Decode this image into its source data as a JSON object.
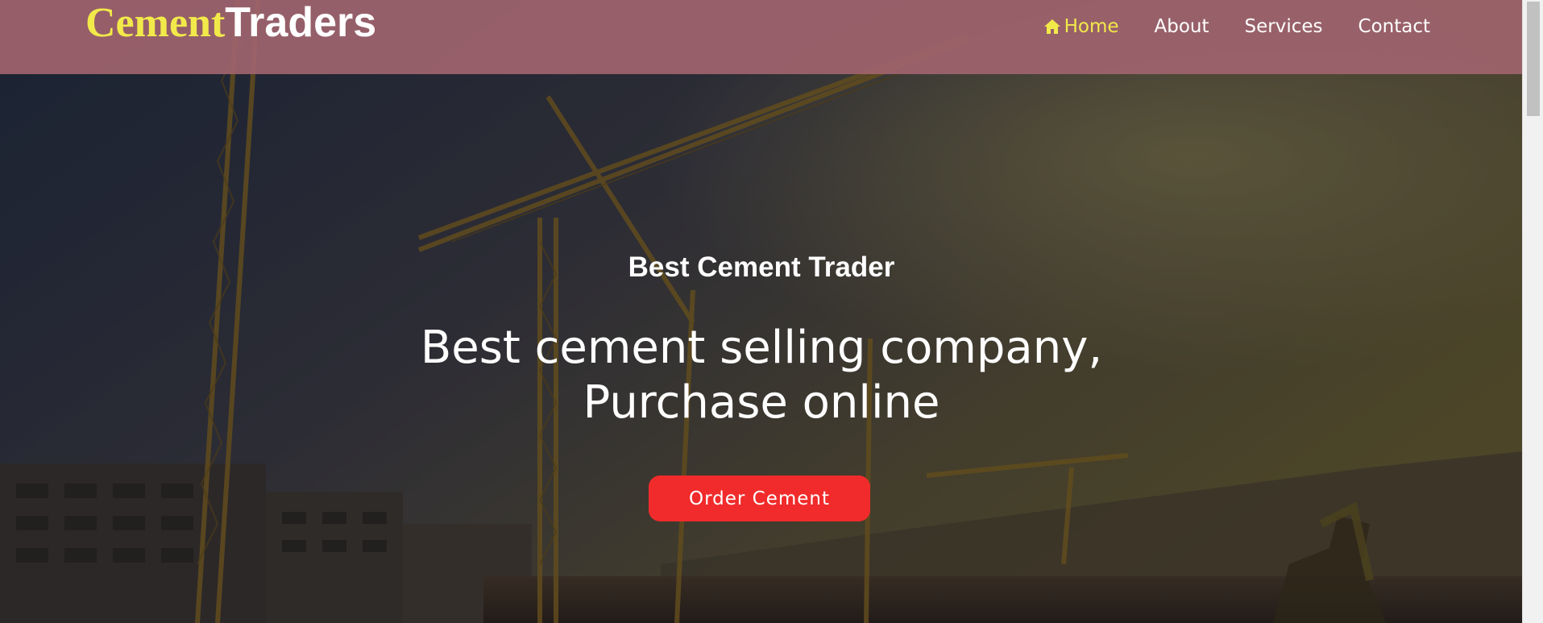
{
  "navbar": {
    "brand_part1": "Cement",
    "brand_part2": "Traders",
    "links": [
      {
        "label": "Home",
        "active": true,
        "icon": "home-icon"
      },
      {
        "label": "About",
        "active": false
      },
      {
        "label": "Services",
        "active": false
      },
      {
        "label": "Contact",
        "active": false
      }
    ]
  },
  "hero": {
    "subtitle": "Best Cement Trader",
    "title_line1": "Best cement selling company,",
    "title_line2": "Purchase online",
    "cta_label": "Order Cement",
    "background": "construction-site-with-cranes-image"
  },
  "colors": {
    "brand_accent": "#f2e94a",
    "navbar_bg": "#a0646e",
    "cta_bg": "#f12b2b"
  }
}
